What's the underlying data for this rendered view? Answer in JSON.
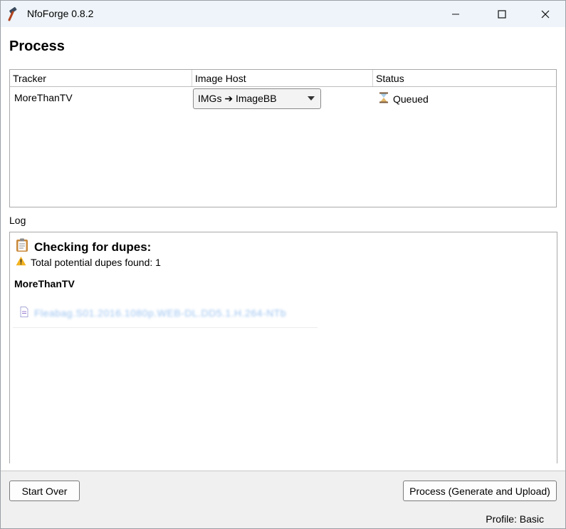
{
  "window": {
    "title": "NfoForge 0.8.2",
    "icons": {
      "app": "hammer-icon",
      "minimize": "minimize-icon",
      "maximize": "maximize-icon",
      "close": "close-icon"
    }
  },
  "page": {
    "title": "Process"
  },
  "table": {
    "headers": [
      "Tracker",
      "Image Host",
      "Status"
    ],
    "rows": [
      {
        "tracker": "MoreThanTV",
        "image_host": "IMGs ➔ ImageBB",
        "status": "Queued",
        "status_icon": "hourglass-icon"
      }
    ]
  },
  "log": {
    "label": "Log",
    "heading": "Checking for dupes:",
    "heading_icon": "clipboard-icon",
    "summary_icon": "warning-icon",
    "summary": "Total potential dupes found: 1",
    "tracker": "MoreThanTV",
    "dupes": [
      {
        "icon": "document-icon",
        "text": "Fleabag.S01.2016.1080p.WEB-DL.DD5.1.H.264-NTb"
      }
    ]
  },
  "footer": {
    "start_over_label": "Start Over",
    "process_label": "Process (Generate and Upload)",
    "profile": "Profile: Basic"
  }
}
